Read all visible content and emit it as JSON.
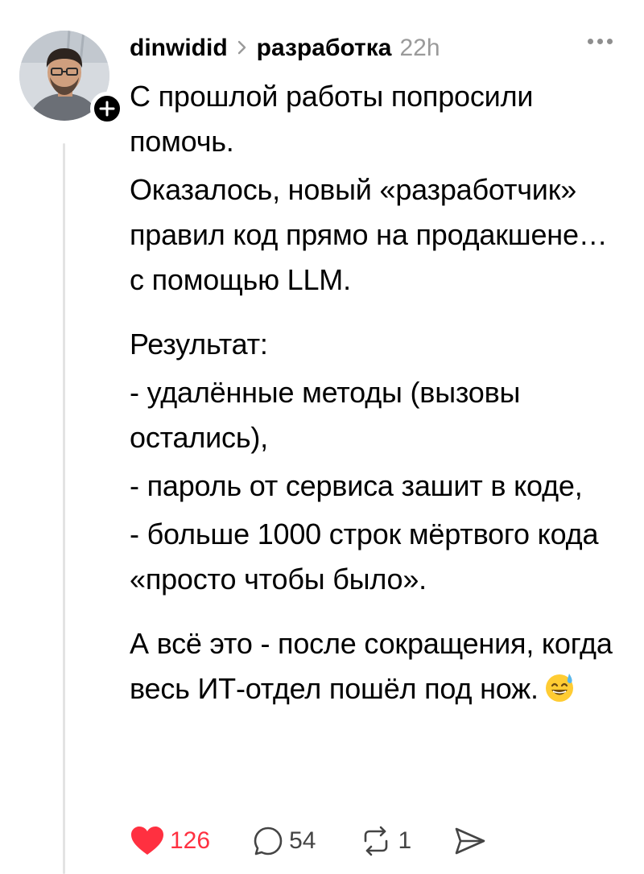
{
  "post": {
    "username": "dinwidid",
    "topic": "разработка",
    "time": "22h",
    "paragraphs": [
      "С прошлой работы попросили помочь.",
      "Оказалось, новый «разработчик» правил код прямо на продакшене… с помощью LLM.",
      "Результат:",
      "- удалённые методы (вызовы остались),",
      "- пароль от сервиса зашит в коде,",
      "- больше 1000 строк мёртвого кода «просто чтобы было».",
      "А всё это - после сокращения, когда весь ИТ-отдел пошёл под нож."
    ],
    "emoji": "sweat-smile"
  },
  "actions": {
    "likes": "126",
    "replies": "54",
    "reposts": "1"
  },
  "colors": {
    "like": "#ff3040",
    "muted": "#9a9a9a",
    "thread_line": "#e3e3e3"
  },
  "icons": [
    "plus-icon",
    "chevron-right-icon",
    "more-icon",
    "heart-icon",
    "comment-icon",
    "repost-icon",
    "share-icon"
  ]
}
